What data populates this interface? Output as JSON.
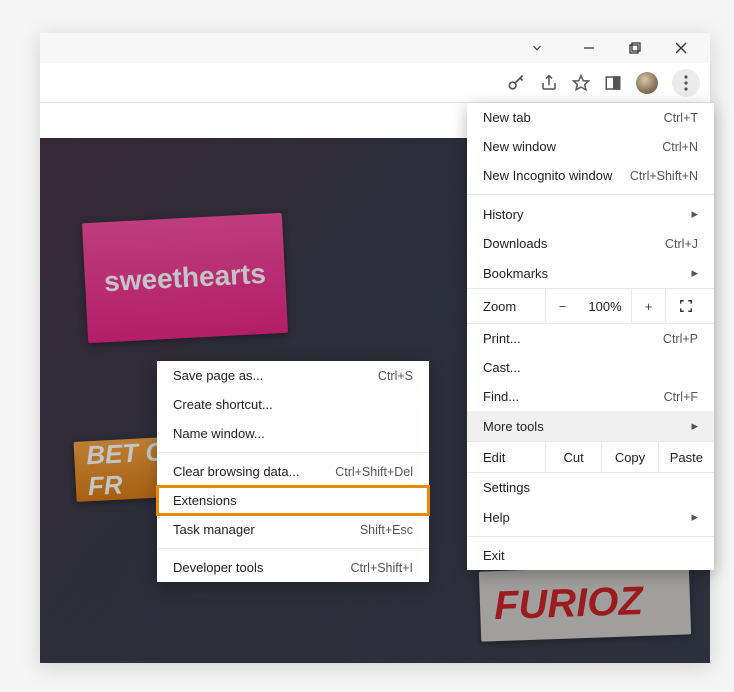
{
  "window_controls": {
    "chevron": "⌄",
    "minimize": "—",
    "maximize": "□",
    "close": "✕"
  },
  "toolbar_icons": {
    "key": "key-icon",
    "share": "share-icon",
    "star": "star-icon",
    "panel": "panel-icon",
    "avatar": "avatar",
    "menu": "menu-icon"
  },
  "content": {
    "tile_sweethearts": "sweethearts",
    "tile_bet": "BET ON FR",
    "tile_furioz": "FURIOZ"
  },
  "menu": {
    "new_tab": {
      "label": "New tab",
      "shortcut": "Ctrl+T"
    },
    "new_window": {
      "label": "New window",
      "shortcut": "Ctrl+N"
    },
    "new_incognito": {
      "label": "New Incognito window",
      "shortcut": "Ctrl+Shift+N"
    },
    "history": {
      "label": "History"
    },
    "downloads": {
      "label": "Downloads",
      "shortcut": "Ctrl+J"
    },
    "bookmarks": {
      "label": "Bookmarks"
    },
    "zoom": {
      "label": "Zoom",
      "minus": "−",
      "value": "100%",
      "plus": "+"
    },
    "print": {
      "label": "Print...",
      "shortcut": "Ctrl+P"
    },
    "cast": {
      "label": "Cast..."
    },
    "find": {
      "label": "Find...",
      "shortcut": "Ctrl+F"
    },
    "more_tools": {
      "label": "More tools"
    },
    "edit": {
      "label": "Edit",
      "cut": "Cut",
      "copy": "Copy",
      "paste": "Paste"
    },
    "settings": {
      "label": "Settings"
    },
    "help": {
      "label": "Help"
    },
    "exit": {
      "label": "Exit"
    }
  },
  "submenu": {
    "save_page": {
      "label": "Save page as...",
      "shortcut": "Ctrl+S"
    },
    "create_shortcut": {
      "label": "Create shortcut..."
    },
    "name_window": {
      "label": "Name window..."
    },
    "clear_browsing": {
      "label": "Clear browsing data...",
      "shortcut": "Ctrl+Shift+Del"
    },
    "extensions": {
      "label": "Extensions"
    },
    "task_manager": {
      "label": "Task manager",
      "shortcut": "Shift+Esc"
    },
    "developer_tools": {
      "label": "Developer tools",
      "shortcut": "Ctrl+Shift+I"
    }
  }
}
